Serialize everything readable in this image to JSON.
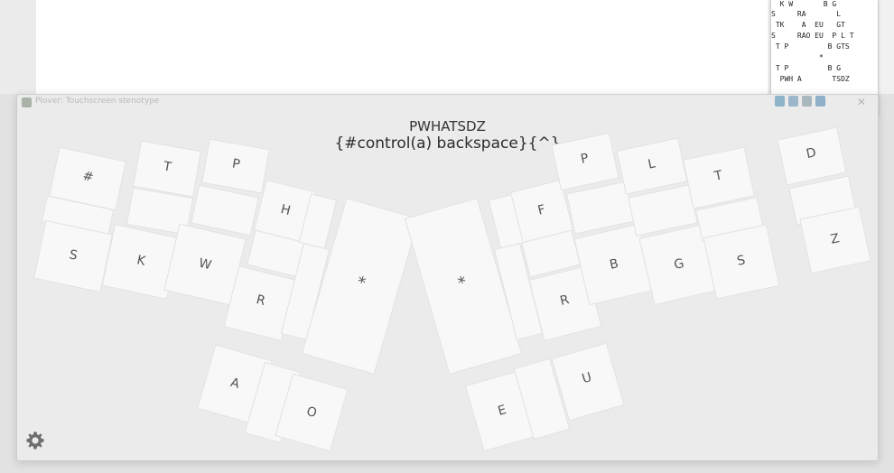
{
  "paper": {
    "lines": [
      "  K W       B G",
      "S     RA       L",
      " TK    A  EU   GT",
      "S     RAO EU  P L T",
      " T P         B GTS",
      "           *",
      " T P         B G",
      "  PWH A       TSDZ"
    ]
  },
  "window": {
    "title": "Plover: Touchscreen stenotype",
    "close": "✕"
  },
  "display": {
    "stroke": "PWHATSDZ",
    "translation": "{#control(a) backspace}{^}"
  },
  "keys": {
    "num": "#",
    "lt": "T",
    "lp": "P",
    "lh": "H",
    "ls": "S",
    "lk": "K",
    "lw": "W",
    "lr": "R",
    "lstar": "*",
    "rstar": "*",
    "rf": "F",
    "rp": "P",
    "rl": "L",
    "rt": "T",
    "rd": "D",
    "rr": "R",
    "rb": "B",
    "rg": "G",
    "rs": "S",
    "rz": "Z",
    "a": "A",
    "o": "O",
    "e": "E",
    "u": "U"
  },
  "icons": {
    "settings": "gear-icon",
    "app": "plover-icon",
    "tools": [
      "pin-icon",
      "columns-icon",
      "trash-icon",
      "save-icon"
    ]
  },
  "colors": {
    "tool_pin": "#8fb3c9",
    "tool_columns": "#9cb7c9",
    "tool_trash": "#a9b7bf",
    "tool_save": "#8fb0c8"
  }
}
